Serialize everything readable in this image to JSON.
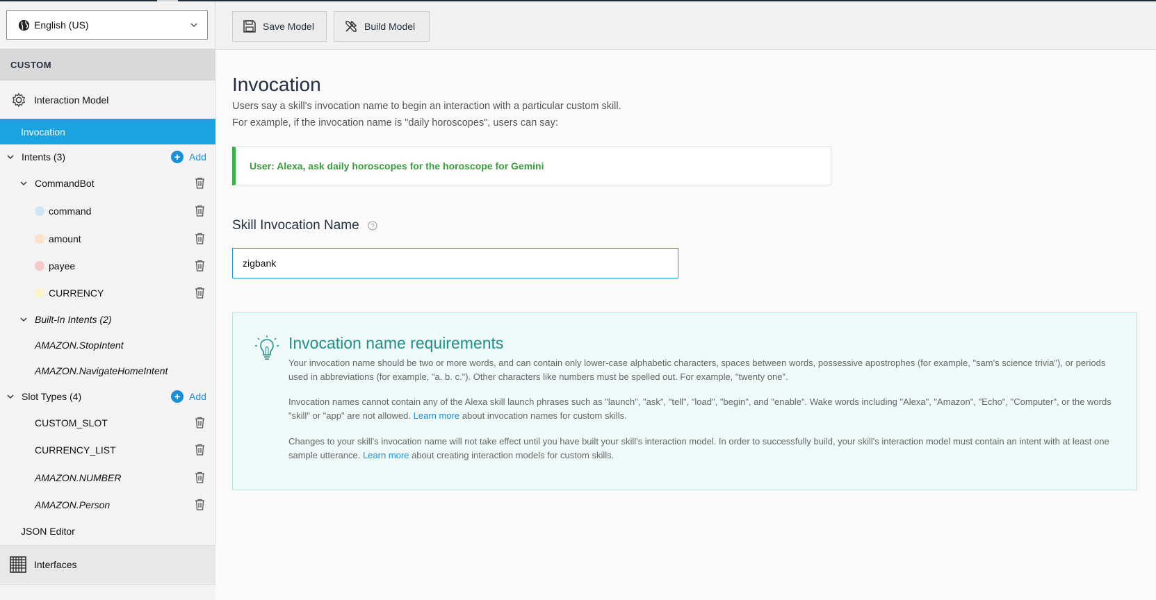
{
  "sidebar": {
    "locale": "English (US)",
    "section_title": "CUSTOM",
    "interaction_model": "Interaction Model",
    "invocation": "Invocation",
    "intents_label": "Intents (3)",
    "add_label": "Add",
    "intent_name": "CommandBot",
    "slots": [
      {
        "label": "command",
        "color": "#cfe6f7"
      },
      {
        "label": "amount",
        "color": "#fbe3c9"
      },
      {
        "label": "payee",
        "color": "#f8c9cb"
      },
      {
        "label": "CURRENCY",
        "color": "#fbf3c9"
      }
    ],
    "builtin_label": "Built-In Intents (2)",
    "builtin_items": [
      "AMAZON.StopIntent",
      "AMAZON.NavigateHomeIntent"
    ],
    "slot_types_label": "Slot Types (4)",
    "slot_types": [
      "CUSTOM_SLOT",
      "CURRENCY_LIST",
      "AMAZON.NUMBER",
      "AMAZON.Person"
    ],
    "json_editor": "JSON Editor",
    "interfaces": "Interfaces"
  },
  "toolbar": {
    "save_label": "Save Model",
    "build_label": "Build Model"
  },
  "main": {
    "title": "Invocation",
    "desc1": "Users say a skill's invocation name to begin an interaction with a particular custom skill.",
    "desc2": "For example, if the invocation name is \"daily horoscopes\", users can say:",
    "example": "User: Alexa, ask daily horoscopes for the horoscope for Gemini",
    "field_label": "Skill Invocation Name",
    "field_value": "zigbank",
    "req_title": "Invocation name requirements",
    "req_p1": "Your invocation name should be two or more words, and can contain only lower-case alphabetic characters, spaces between words, possessive apostrophes (for example, \"sam's science trivia\"), or periods used in abbreviations (for example, \"a. b. c.\"). Other characters like numbers must be spelled out. For example, \"twenty one\".",
    "req_p2_a": "Invocation names cannot contain any of the Alexa skill launch phrases such as \"launch\", \"ask\", \"tell\", \"load\", \"begin\", and \"enable\". Wake words including \"Alexa\", \"Amazon\", \"Echo\", \"Computer\", or the words \"skill\" or \"app\" are not allowed.",
    "req_p2_link": "Learn more",
    "req_p2_b": "about invocation names for custom skills.",
    "req_p3_a": "Changes to your skill's invocation name will not take effect until you have built your skill's interaction model. In order to successfully build, your skill's interaction model must contain an intent with at least one sample utterance.",
    "req_p3_link": "Learn more",
    "req_p3_b": "about creating interaction models for custom skills."
  },
  "colors": {
    "accent": "#1aa3e0",
    "success": "#3ab24a",
    "teal": "#1f8f8b"
  }
}
